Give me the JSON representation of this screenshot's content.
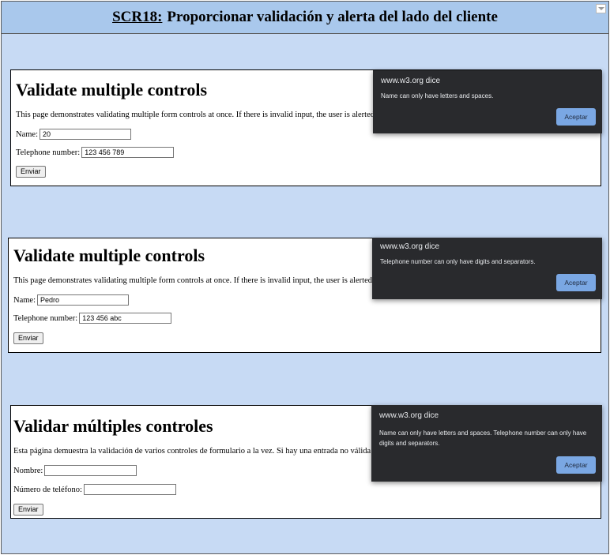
{
  "title": {
    "code": "SCR18:",
    "text": "Proporcionar validación y alerta del lado del cliente"
  },
  "panels": [
    {
      "heading": "Validate multiple controls",
      "description": "This page demonstrates validating multiple form controls at once. If there is invalid input, the user is alerted",
      "name_label": "Name:",
      "name_value": "20",
      "phone_label": "Telephone number:",
      "phone_value": "123 456 789",
      "submit_label": "Enviar",
      "dialog": {
        "origin": "www.w3.org dice",
        "message": "Name can only have letters and spaces.",
        "ok_label": "Aceptar"
      }
    },
    {
      "heading": "Validate multiple controls",
      "description": "This page demonstrates validating multiple form controls at once. If there is invalid input, the user is alerted",
      "name_label": "Name:",
      "name_value": "Pedro",
      "phone_label": "Telephone number:",
      "phone_value": "123 456 abc",
      "submit_label": "Enviar",
      "dialog": {
        "origin": "www.w3.org dice",
        "message": "Telephone number can only have digits and separators.",
        "ok_label": "Aceptar"
      }
    },
    {
      "heading": "Validar múltiples controles",
      "description": "Esta página demuestra la validación de varios controles de formulario a la vez. Si hay una entrada no válida",
      "name_label": "Nombre:",
      "name_value": "",
      "phone_label": "Número de teléfono:",
      "phone_value": "",
      "submit_label": "Enviar",
      "dialog": {
        "origin": "www.w3.org dice",
        "message": "Name can only have letters and spaces. Telephone number can only have digits and separators.",
        "ok_label": "Aceptar"
      }
    }
  ]
}
